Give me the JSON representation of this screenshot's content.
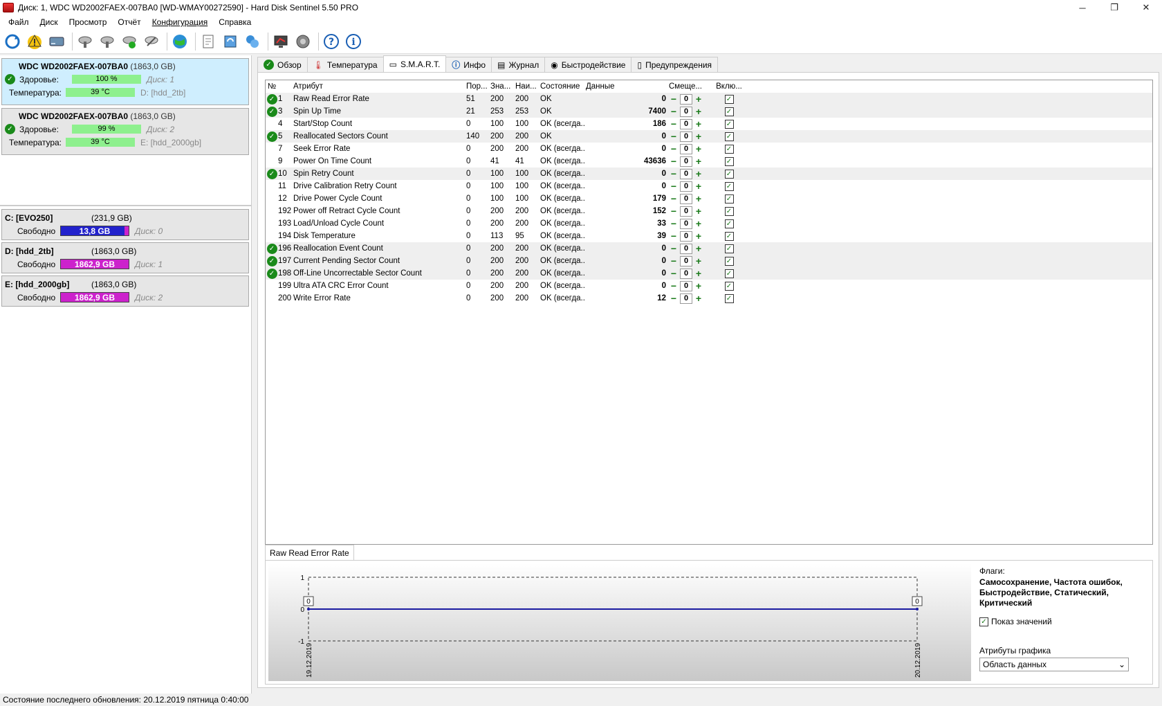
{
  "window": {
    "title": "Диск: 1, WDC WD2002FAEX-007BA0 [WD-WMAY00272590]  -  Hard Disk Sentinel 5.50 PRO",
    "minimize": "─",
    "restore": "❐",
    "close": "✕"
  },
  "menu": {
    "file": "Файл",
    "disk": "Диск",
    "view": "Просмотр",
    "report": "Отчёт",
    "config": "Конфигурация",
    "help": "Справка"
  },
  "disks": [
    {
      "name": "WDC WD2002FAEX-007BA0",
      "size": "(1863,0 GB)",
      "health_label": "Здоровье:",
      "health": "100 %",
      "health_fraction": 1.0,
      "disk_label": "Диск: 1",
      "temp_label": "Температура:",
      "temp": "39 °C",
      "volume": "D: [hdd_2tb]"
    },
    {
      "name": "WDC WD2002FAEX-007BA0",
      "size": "(1863,0 GB)",
      "health_label": "Здоровье:",
      "health": "99 %",
      "health_fraction": 0.99,
      "disk_label": "Диск: 2",
      "temp_label": "Температура:",
      "temp": "39 °C",
      "volume": "E: [hdd_2000gb]"
    }
  ],
  "volumes": [
    {
      "name": "C: [EVO250]",
      "size": "(231,9 GB)",
      "free_label": "Свободно",
      "free": "13,8 GB",
      "free_fraction": 0.06,
      "color": "#2222cc",
      "disk": "Диск: 0"
    },
    {
      "name": "D: [hdd_2tb]",
      "size": "(1863,0 GB)",
      "free_label": "Свободно",
      "free": "1862,9 GB",
      "free_fraction": 1.0,
      "color": "#cc22cc",
      "disk": "Диск: 1"
    },
    {
      "name": "E: [hdd_2000gb]",
      "size": "(1863,0 GB)",
      "free_label": "Свободно",
      "free": "1862,9 GB",
      "free_fraction": 1.0,
      "color": "#cc22cc",
      "disk": "Диск: 2"
    }
  ],
  "tabs": [
    "Обзор",
    "Температура",
    "S.M.A.R.T.",
    "Инфо",
    "Журнал",
    "Быстродействие",
    "Предупреждения"
  ],
  "smart_headers": {
    "num": "№",
    "attr": "Атрибут",
    "threshold": "Пор...",
    "value": "Зна...",
    "worst": "Наи...",
    "state": "Состояние",
    "data": "Данные",
    "offset": "Смеще...",
    "enabled": "Вклю..."
  },
  "smart_rows": [
    {
      "ok": true,
      "num": "1",
      "attr": "Raw Read Error Rate",
      "thr": "51",
      "val": "200",
      "worst": "200",
      "state": "OK",
      "data": "0",
      "off": "0"
    },
    {
      "ok": true,
      "num": "3",
      "attr": "Spin Up Time",
      "thr": "21",
      "val": "253",
      "worst": "253",
      "state": "OK",
      "data": "7400",
      "off": "0"
    },
    {
      "ok": false,
      "num": "4",
      "attr": "Start/Stop Count",
      "thr": "0",
      "val": "100",
      "worst": "100",
      "state": "OK (всегда...",
      "data": "186",
      "off": "0"
    },
    {
      "ok": true,
      "num": "5",
      "attr": "Reallocated Sectors Count",
      "thr": "140",
      "val": "200",
      "worst": "200",
      "state": "OK",
      "data": "0",
      "off": "0"
    },
    {
      "ok": false,
      "num": "7",
      "attr": "Seek Error Rate",
      "thr": "0",
      "val": "200",
      "worst": "200",
      "state": "OK (всегда...",
      "data": "0",
      "off": "0"
    },
    {
      "ok": false,
      "num": "9",
      "attr": "Power On Time Count",
      "thr": "0",
      "val": "41",
      "worst": "41",
      "state": "OK (всегда...",
      "data": "43636",
      "off": "0"
    },
    {
      "ok": true,
      "num": "10",
      "attr": "Spin Retry Count",
      "thr": "0",
      "val": "100",
      "worst": "100",
      "state": "OK (всегда...",
      "data": "0",
      "off": "0"
    },
    {
      "ok": false,
      "num": "11",
      "attr": "Drive Calibration Retry Count",
      "thr": "0",
      "val": "100",
      "worst": "100",
      "state": "OK (всегда...",
      "data": "0",
      "off": "0"
    },
    {
      "ok": false,
      "num": "12",
      "attr": "Drive Power Cycle Count",
      "thr": "0",
      "val": "100",
      "worst": "100",
      "state": "OK (всегда...",
      "data": "179",
      "off": "0"
    },
    {
      "ok": false,
      "num": "192",
      "attr": "Power off Retract Cycle Count",
      "thr": "0",
      "val": "200",
      "worst": "200",
      "state": "OK (всегда...",
      "data": "152",
      "off": "0"
    },
    {
      "ok": false,
      "num": "193",
      "attr": "Load/Unload Cycle Count",
      "thr": "0",
      "val": "200",
      "worst": "200",
      "state": "OK (всегда...",
      "data": "33",
      "off": "0"
    },
    {
      "ok": false,
      "num": "194",
      "attr": "Disk Temperature",
      "thr": "0",
      "val": "113",
      "worst": "95",
      "state": "OK (всегда...",
      "data": "39",
      "off": "0"
    },
    {
      "ok": true,
      "num": "196",
      "attr": "Reallocation Event Count",
      "thr": "0",
      "val": "200",
      "worst": "200",
      "state": "OK (всегда...",
      "data": "0",
      "off": "0"
    },
    {
      "ok": true,
      "num": "197",
      "attr": "Current Pending Sector Count",
      "thr": "0",
      "val": "200",
      "worst": "200",
      "state": "OK (всегда...",
      "data": "0",
      "off": "0"
    },
    {
      "ok": true,
      "num": "198",
      "attr": "Off-Line Uncorrectable Sector Count",
      "thr": "0",
      "val": "200",
      "worst": "200",
      "state": "OK (всегда...",
      "data": "0",
      "off": "0"
    },
    {
      "ok": false,
      "num": "199",
      "attr": "Ultra ATA CRC Error Count",
      "thr": "0",
      "val": "200",
      "worst": "200",
      "state": "OK (всегда...",
      "data": "0",
      "off": "0"
    },
    {
      "ok": false,
      "num": "200",
      "attr": "Write Error Rate",
      "thr": "0",
      "val": "200",
      "worst": "200",
      "state": "OK (всегда...",
      "data": "12",
      "off": "0"
    }
  ],
  "graph": {
    "tab": "Raw Read Error Rate",
    "y_ticks": [
      "1",
      "0",
      "-1"
    ],
    "x_labels": [
      "19.12.2019",
      "20.12.2019"
    ],
    "point_labels": [
      "0",
      "0"
    ],
    "values": [
      0,
      0
    ]
  },
  "flags": {
    "label": "Флаги:",
    "text": "Самосохранение, Частота ошибок, Быстродействие, Статический, Критический",
    "show_values": "Показ значений",
    "graph_attr_label": "Атрибуты графика",
    "graph_attr_value": "Область данных"
  },
  "status": "Состояние последнего обновления: 20.12.2019 пятница 0:40:00"
}
